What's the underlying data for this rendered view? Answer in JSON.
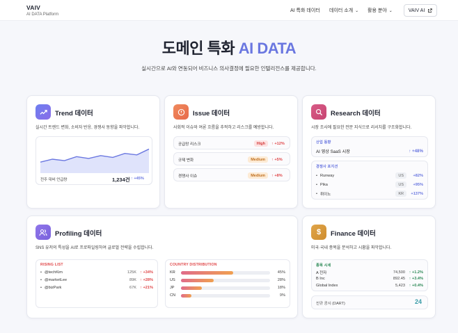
{
  "nav": {
    "brand_title": "VAIV",
    "brand_sub": "AI DATA Platform",
    "items": [
      "AI 특화 데이터",
      "데이터 소개",
      "활용 분야"
    ],
    "button_label": "VAIV AI"
  },
  "hero": {
    "title_main": "도메인 특화",
    "title_accent": "AI DATA",
    "subtitle": "실시간으로 AI와 연동되어 비즈니스 의사결정에 필요한 인텔리전스를 제공합니다."
  },
  "trend": {
    "title": "Trend 데이터",
    "desc": "실시간 트렌드 변화, 소비자 반응, 경쟁사 동향을 파악합니다.",
    "metric_label": "전주 대비 언급량",
    "metric_value": "1,234건",
    "metric_change": "↑ +45%",
    "sparkline": [
      0.42,
      0.5,
      0.46,
      0.57,
      0.52,
      0.6,
      0.55,
      0.66,
      0.62,
      0.78
    ]
  },
  "issue": {
    "title": "Issue 데이터",
    "desc": "사회적 이슈와 여론 흐름을 추적하고 리스크를 예방합니다.",
    "rows": [
      {
        "label": "공급망 리스크",
        "level": "High",
        "change": "↑ +12%"
      },
      {
        "label": "규제 변화",
        "level": "Medium",
        "change": "↑ +5%"
      },
      {
        "label": "경쟁사 이슈",
        "level": "Medium",
        "change": "↑ +8%"
      }
    ]
  },
  "research": {
    "title": "Research 데이터",
    "desc": "시장 조사에 필요한 전문 지식으로 리서치를 구조화합니다.",
    "trend_label": "산업 동향",
    "trend_item": "AI 영상 SaaS 시장",
    "trend_change": "↑ +48%",
    "comp_label": "경쟁사 포지션",
    "competitors": [
      {
        "name": "Runway",
        "country": "US",
        "change": "+82%"
      },
      {
        "name": "Pika",
        "country": "US",
        "change": "+95%"
      },
      {
        "name": "뤼이노",
        "country": "KR",
        "change": "+137%"
      }
    ]
  },
  "profiling": {
    "title": "Profiling 데이터",
    "desc": "SNS 유저의 특성을 AI로 프로파일링하여 글로벌 전략을 수립합니다.",
    "rising_label": "RISING LIST",
    "rising": [
      {
        "name": "@techKim",
        "count": "125K",
        "change": "↑ +34%"
      },
      {
        "name": "@marketLee",
        "count": "89K",
        "change": "↑ +28%"
      },
      {
        "name": "@bizPark",
        "count": "67K",
        "change": "↑ +21%"
      }
    ],
    "country_label": "COUNTRY DISTRIBUTION",
    "countries": [
      {
        "code": "KR",
        "value": 45,
        "label": "45%"
      },
      {
        "code": "US",
        "value": 28,
        "label": "28%"
      },
      {
        "code": "JP",
        "value": 18,
        "label": "18%"
      },
      {
        "code": "CN",
        "value": 9,
        "label": "9%"
      }
    ]
  },
  "finance": {
    "title": "Finance 데이터",
    "desc": "미국·국내 종목을 분석하고 시황을 파악합니다.",
    "stock_label": "종목 시세",
    "stocks": [
      {
        "name": "A 전자",
        "price": "74,500",
        "change": "↑ +1.2%"
      },
      {
        "name": "B Inc",
        "price": "892.45",
        "change": "↑ +3.4%"
      },
      {
        "name": "Global Index",
        "price": "5,423",
        "change": "↑ +0.4%"
      }
    ],
    "dart_label": "신규 공시 (DART)",
    "dart_value": "24"
  },
  "colors": {
    "accent": "#6a77e0",
    "green": "#2e8a57",
    "red": "#e0484a"
  }
}
